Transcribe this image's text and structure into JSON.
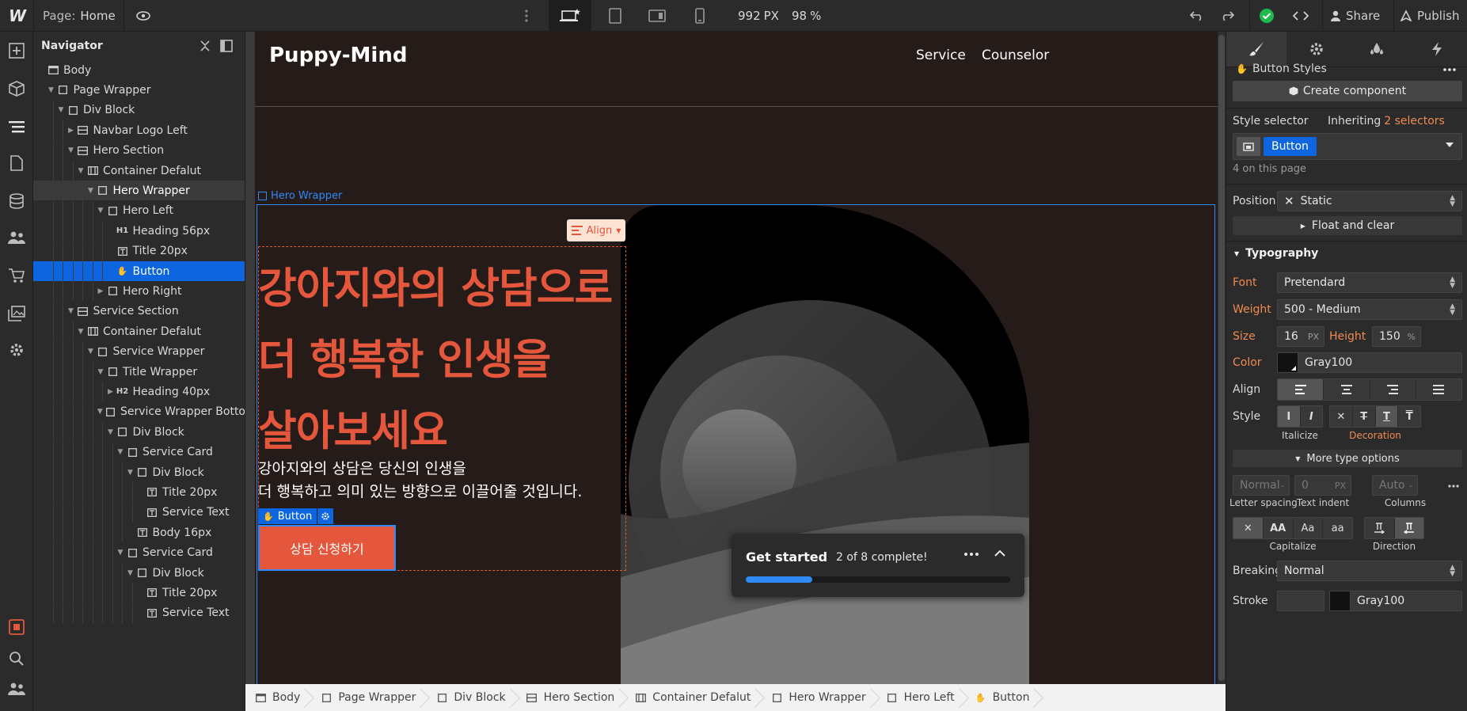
{
  "topbar": {
    "logo": "W",
    "page_label": "Page:",
    "page_name": "Home",
    "viewport_width": "992",
    "viewport_unit": "PX",
    "zoom": "98",
    "zoom_unit": "%",
    "share": "Share",
    "publish": "Publish"
  },
  "navigator": {
    "title": "Navigator",
    "items": [
      {
        "label": "Body",
        "icon": "body"
      },
      {
        "label": "Page Wrapper",
        "icon": "box"
      },
      {
        "label": "Div Block",
        "icon": "box"
      },
      {
        "label": "Navbar Logo Left",
        "icon": "section"
      },
      {
        "label": "Hero Section",
        "icon": "section"
      },
      {
        "label": "Container Defalut",
        "icon": "container"
      },
      {
        "label": "Hero Wrapper",
        "icon": "box"
      },
      {
        "label": "Hero Left",
        "icon": "box"
      },
      {
        "label": "Heading 56px",
        "icon": "H1"
      },
      {
        "label": "Title 20px",
        "icon": "text"
      },
      {
        "label": "Button",
        "icon": "hand"
      },
      {
        "label": "Hero Right",
        "icon": "box"
      },
      {
        "label": "Service Section",
        "icon": "section"
      },
      {
        "label": "Container Defalut",
        "icon": "container"
      },
      {
        "label": "Service Wrapper",
        "icon": "box"
      },
      {
        "label": "Title Wrapper",
        "icon": "box"
      },
      {
        "label": "Heading 40px",
        "icon": "H2"
      },
      {
        "label": "Service Wrapper Botto",
        "icon": "box"
      },
      {
        "label": "Div Block",
        "icon": "box"
      },
      {
        "label": "Service Card",
        "icon": "box"
      },
      {
        "label": "Div Block",
        "icon": "box"
      },
      {
        "label": "Title 20px",
        "icon": "text"
      },
      {
        "label": "Service Text",
        "icon": "text"
      },
      {
        "label": "Body 16px",
        "icon": "text"
      },
      {
        "label": "Service Card",
        "icon": "box"
      },
      {
        "label": "Div Block",
        "icon": "box"
      },
      {
        "label": "Title 20px",
        "icon": "text"
      },
      {
        "label": "Service Text",
        "icon": "text"
      }
    ]
  },
  "canvas": {
    "brand": "Puppy-Mind",
    "nav_links": [
      "Service",
      "Counselor"
    ],
    "hero_wrapper_label": "Hero Wrapper",
    "align_label": "Align",
    "heading_lines": [
      "강아지와의 상담으로",
      "더 행복한 인생을",
      "살아보세요"
    ],
    "sub_lines": [
      "강아지와의 상담은 당신의 인생을",
      "더 행복하고 의미 있는 방향으로 이끌어줄 것입니다."
    ],
    "button_tag": "Button",
    "cta": "상담 신청하기",
    "get_started": {
      "title": "Get started",
      "progress_text": "2 of 8 complete!",
      "progress": 0.25
    }
  },
  "breadcrumb": [
    {
      "label": "Body",
      "icon": "body"
    },
    {
      "label": "Page Wrapper",
      "icon": "box"
    },
    {
      "label": "Div Block",
      "icon": "box"
    },
    {
      "label": "Hero Section",
      "icon": "section"
    },
    {
      "label": "Container Defalut",
      "icon": "container"
    },
    {
      "label": "Hero Wrapper",
      "icon": "box"
    },
    {
      "label": "Hero Left",
      "icon": "box"
    },
    {
      "label": "Button",
      "icon": "hand"
    }
  ],
  "panel": {
    "element_title": "Button Styles",
    "create_component": "Create component",
    "style_selector": "Style selector",
    "inheriting": "Inheriting",
    "selectors_count": "2 selectors",
    "selector_chip": "Button",
    "on_page": "4 on this page",
    "position_label": "Position",
    "position_value": "Static",
    "float_clear": "Float and clear",
    "typography": "Typography",
    "font_label": "Font",
    "font_value": "Pretendard",
    "weight_label": "Weight",
    "weight_value": "500 - Medium",
    "size_label": "Size",
    "size_value": "16",
    "size_unit": "PX",
    "height_label": "Height",
    "height_value": "150",
    "height_unit": "%",
    "color_label": "Color",
    "color_value": "Gray100",
    "align_label": "Align",
    "style_label": "Style",
    "italicize": "Italicize",
    "decoration": "Decoration",
    "more_type": "More type options",
    "letter_placeholder": "Normal",
    "indent_placeholder": "0",
    "indent_unit": "PX",
    "columns_placeholder": "Auto",
    "letter_spacing": "Letter spacing",
    "text_indent": "Text indent",
    "columns": "Columns",
    "capitalize": "Capitalize",
    "direction": "Direction",
    "breaking_label": "Breaking",
    "breaking_value": "Normal",
    "stroke_label": "Stroke",
    "stroke_color": "Gray100"
  },
  "colors": {
    "accent_orange": "#e4573d",
    "selection_blue": "#0d66e0",
    "canvas_bg": "#251b18",
    "success_green": "#1fb84a"
  }
}
